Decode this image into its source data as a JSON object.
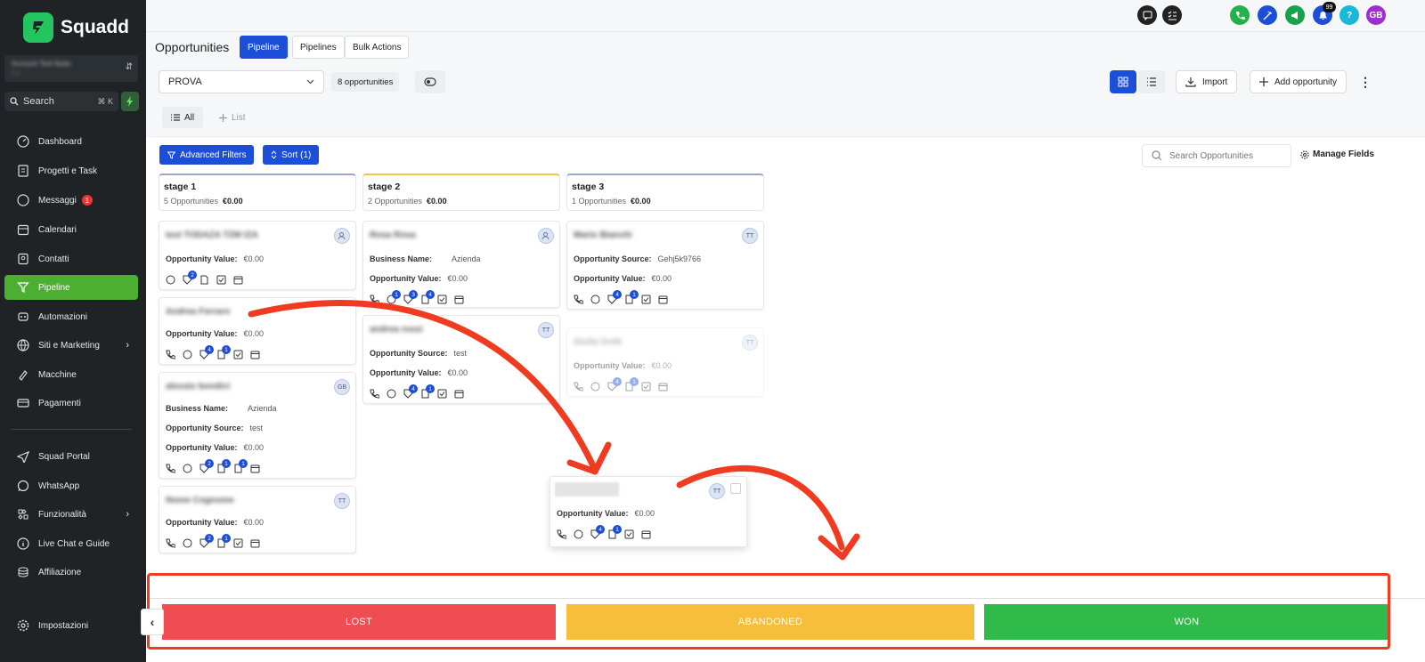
{
  "brand": {
    "name": "Squadd",
    "accent": "#22c55e"
  },
  "account": {
    "name": "Account Test Nuke",
    "sub": "1.1"
  },
  "search": {
    "label": "Search",
    "shortcut": "⌘ K"
  },
  "nav": {
    "items": [
      {
        "label": "Dashboard",
        "icon": "dashboard-icon"
      },
      {
        "label": "Progetti e Task",
        "icon": "projects-icon"
      },
      {
        "label": "Messaggi",
        "icon": "messages-icon",
        "badge": "1"
      },
      {
        "label": "Calendari",
        "icon": "calendar-icon"
      },
      {
        "label": "Contatti",
        "icon": "contacts-icon"
      },
      {
        "label": "Pipeline",
        "icon": "pipeline-icon",
        "active": true
      },
      {
        "label": "Automazioni",
        "icon": "automation-icon"
      },
      {
        "label": "Siti e Marketing",
        "icon": "globe-icon",
        "chevron": true
      },
      {
        "label": "Macchine",
        "icon": "machine-icon"
      },
      {
        "label": "Pagamenti",
        "icon": "payments-icon"
      }
    ],
    "bottom": [
      {
        "label": "Squad Portal",
        "icon": "send-icon"
      },
      {
        "label": "WhatsApp",
        "icon": "whatsapp-icon"
      },
      {
        "label": "Funzionalità",
        "icon": "features-icon",
        "chevron": true
      },
      {
        "label": "Live Chat e Guide",
        "icon": "info-icon"
      },
      {
        "label": "Affiliazione",
        "icon": "coins-icon"
      }
    ],
    "settings": "Impostazioni"
  },
  "topbar": {
    "notifications": "99",
    "user_initials": "GB",
    "help": "?"
  },
  "page": {
    "title": "Opportunities",
    "tabs": [
      "Pipeline",
      "Pipelines",
      "Bulk Actions"
    ]
  },
  "toolbar": {
    "pipeline_select": "PROVA",
    "opportunity_count": "8 opportunities",
    "import": "Import",
    "add": "Add opportunity"
  },
  "filters": {
    "all": "All",
    "list": "List",
    "advanced": "Advanced Filters",
    "sort": "Sort (1)",
    "search_placeholder": "Search Opportunities",
    "manage": "Manage Fields"
  },
  "labels": {
    "opportunity_value": "Opportunity Value:",
    "business_name": "Business Name:",
    "opportunity_source": "Opportunity Source:"
  },
  "stages": [
    {
      "name": "stage 1",
      "count": "5 Opportunities",
      "value": "€0.00",
      "color": "#9aa6c4"
    },
    {
      "name": "stage 2",
      "count": "2 Opportunities",
      "value": "€0.00",
      "color": "#f5c04a"
    },
    {
      "name": "stage 3",
      "count": "1 Opportunities",
      "value": "€0.00",
      "color": "#9aa6c4"
    }
  ],
  "cards": [
    {
      "name": "test TODAZA TZM IZA",
      "value": "€0.00"
    },
    {
      "name": "Andrea Ferraro",
      "value": "€0.00"
    },
    {
      "name": "alessio bondici",
      "business": "Azienda",
      "source": "test",
      "value": "€0.00",
      "avatar": "GB"
    },
    {
      "name": "Nome Cognome",
      "value": "€0.00",
      "avatar": "TT"
    },
    {
      "name": "Rosa Rosa",
      "business": "Azienda",
      "value": "€0.00"
    },
    {
      "name": "andrea rossi",
      "source": "test",
      "value": "€0.00",
      "avatar": "TT"
    },
    {
      "name": "Mario Bianchi",
      "source": "Gehj5k9766",
      "value": "€0.00",
      "avatar": "TT"
    },
    {
      "name": "Giulia Gotti",
      "value": "€0.00",
      "avatar": "TT"
    },
    {
      "value": "€0.00",
      "avatar": "TT"
    }
  ],
  "badges": {
    "b1": "2",
    "b2": "4",
    "b3": "1",
    "b4": "3"
  },
  "dropzones": [
    {
      "label": "LOST",
      "color": "#ef4d52"
    },
    {
      "label": "ABANDONED",
      "color": "#f7be3b"
    },
    {
      "label": "WON",
      "color": "#2fba4a"
    }
  ]
}
